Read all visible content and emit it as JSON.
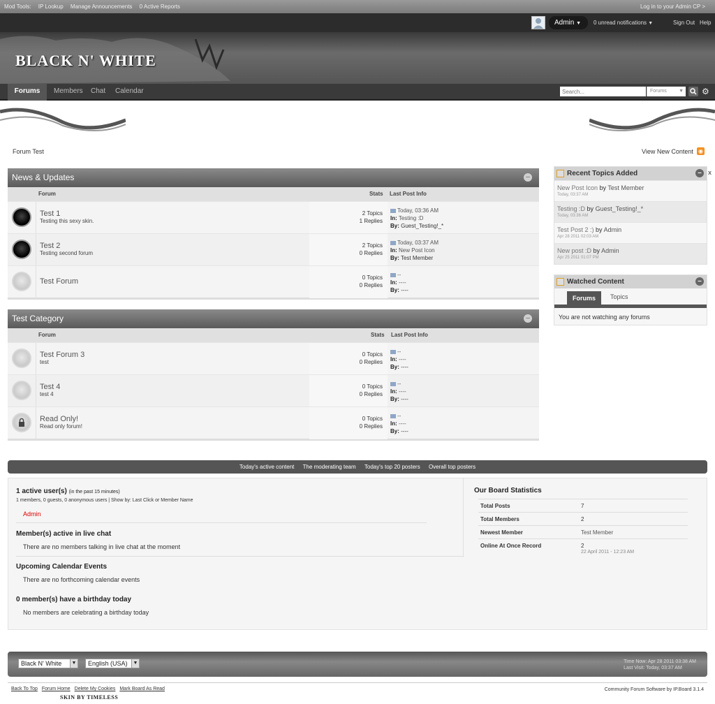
{
  "modbar": {
    "items": [
      "Mod Tools:",
      "IP Lookup",
      "Manage Announcements",
      "0 Active Reports"
    ],
    "admin_link": "Log in to your Admin CP >"
  },
  "userbar": {
    "username": "Admin",
    "notifications": "0 unread notifications",
    "sign_out": "Sign Out",
    "help": "Help"
  },
  "logo": "BLACK N' WHITE",
  "nav": {
    "tabs": [
      "Forums",
      "Members",
      "Chat",
      "Calendar"
    ],
    "active": "Forums"
  },
  "search": {
    "placeholder": "Search...",
    "scope": "Forums"
  },
  "breadcrumb": "Forum Test",
  "view_new": "View New Content",
  "categories": [
    {
      "title": "News & Updates",
      "cols": {
        "forum": "Forum",
        "stats": "Stats",
        "last": "Last Post Info"
      },
      "rows": [
        {
          "name": "Test 1",
          "desc": "Testing this sexy skin.",
          "topics": "2 Topics",
          "replies": "1 Replies",
          "l1": "Today, 03:36 AM",
          "in_label": "In:",
          "in_val": "Testing :D",
          "by_label": "By:",
          "by_val": "Guest_Testing!_*",
          "icon": "dark"
        },
        {
          "name": "Test 2",
          "desc": "Testing second forum",
          "topics": "2 Topics",
          "replies": "0 Replies",
          "l1": "Today, 03:37 AM",
          "in_label": "In:",
          "in_val": "New Post Icon",
          "by_label": "By:",
          "by_val": "Test Member",
          "icon": "dark"
        },
        {
          "name": "Test Forum",
          "desc": "",
          "topics": "0 Topics",
          "replies": "0 Replies",
          "l1": "--",
          "in_label": "In:",
          "in_val": "----",
          "by_label": "By:",
          "by_val": "----",
          "icon": "light"
        }
      ]
    },
    {
      "title": "Test Category",
      "cols": {
        "forum": "Forum",
        "stats": "Stats",
        "last": "Last Post Info"
      },
      "rows": [
        {
          "name": "Test Forum 3",
          "desc": "test",
          "topics": "0 Topics",
          "replies": "0 Replies",
          "l1": "--",
          "in_label": "In:",
          "in_val": "----",
          "by_label": "By:",
          "by_val": "----",
          "icon": "light"
        },
        {
          "name": "Test 4",
          "desc": "test 4",
          "topics": "0 Topics",
          "replies": "0 Replies",
          "l1": "--",
          "in_label": "In:",
          "in_val": "----",
          "by_label": "By:",
          "by_val": "----",
          "icon": "light"
        },
        {
          "name": "Read Only!",
          "desc": "Read only forum!",
          "topics": "0 Topics",
          "replies": "0 Replies",
          "l1": "--",
          "in_label": "In:",
          "in_val": "----",
          "by_label": "By:",
          "by_val": "----",
          "icon": "lock"
        }
      ]
    }
  ],
  "recent": {
    "title": "Recent Topics Added",
    "close": "x",
    "items": [
      {
        "title": "New Post Icon",
        "by": "by",
        "user": "Test Member",
        "date": "Today, 03:37 AM"
      },
      {
        "title": "Testing :D",
        "by": "by",
        "user": "Guest_Testing!_*",
        "date": "Today, 03:36 AM"
      },
      {
        "title": "Test Post 2 :)",
        "by": "by",
        "user": "Admin",
        "date": "Apr 28 2011 02:03 AM"
      },
      {
        "title": "New post :D",
        "by": "by",
        "user": "Admin",
        "date": "Apr 25 2011 01:07 PM"
      }
    ]
  },
  "watched": {
    "title": "Watched Content",
    "tabs": [
      "Forums",
      "Topics"
    ],
    "message": "You are not watching any forums"
  },
  "linkbar": [
    "Today's active content",
    "The moderating team",
    "Today's top 20 posters",
    "Overall top posters"
  ],
  "stats": {
    "active_title": "1 active user(s)",
    "active_note": "(in the past 15 minutes)",
    "active_detail": "1 members, 0 guests, 0 anonymous users | Show by: Last Click or Member Name",
    "active_user": "Admin",
    "chat_title": "Member(s) active in live chat",
    "chat_msg": "There are no members talking in live chat at the moment",
    "cal_title": "Upcoming Calendar Events",
    "cal_msg": "There are no forthcoming calendar events",
    "bday_title": "0 member(s) have a birthday today",
    "bday_msg": "No members are celebrating a birthday today",
    "board_title": "Our Board Statistics",
    "board": [
      {
        "k": "Total Posts",
        "v": "7"
      },
      {
        "k": "Total Members",
        "v": "2"
      },
      {
        "k": "Newest Member",
        "v": "Test Member"
      },
      {
        "k": "Online At Once Record",
        "v": "2",
        "sub": "22 April 2011 - 12:23 AM"
      }
    ]
  },
  "footer": {
    "skin": "Black N' White",
    "lang": "English (USA)",
    "time": "Time Now: Apr 28 2011 03:38 AM",
    "visit": "Last Visit: Today, 03:37 AM",
    "links": [
      "Back To Top",
      "Forum Home",
      "Delete My Cookies",
      "Mark Board As Read"
    ],
    "skinby": "SKIN BY TIMELESS",
    "credit": "Community Forum Software by IP.Board 3.1.4"
  }
}
